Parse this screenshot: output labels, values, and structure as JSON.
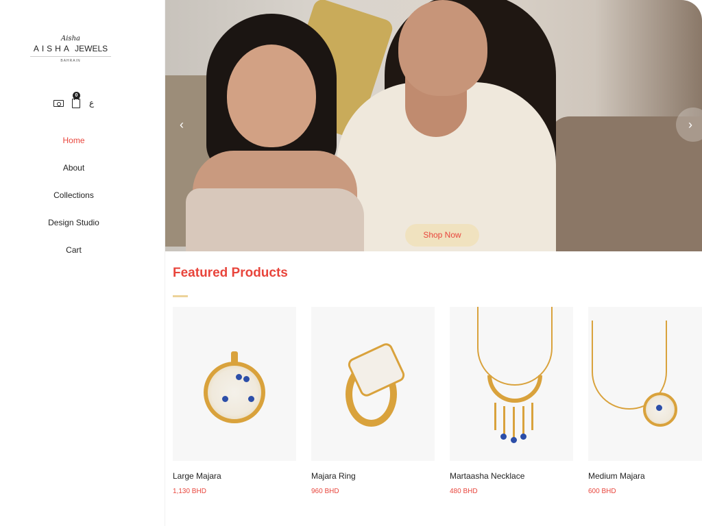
{
  "brand": {
    "script": "Aisha",
    "name_part1": "AISHA",
    "name_part2": "JEWELS",
    "location": "BAHRAIN"
  },
  "header_icons": {
    "currency_icon": "money-icon",
    "cart_icon": "shopping-bag-icon",
    "cart_count": "0",
    "language_toggle": "ع"
  },
  "nav": {
    "items": [
      {
        "label": "Home",
        "active": true
      },
      {
        "label": "About",
        "active": false
      },
      {
        "label": "Collections",
        "active": false
      },
      {
        "label": "Design Studio",
        "active": false
      },
      {
        "label": "Cart",
        "active": false
      }
    ]
  },
  "hero": {
    "prev_icon": "‹",
    "next_icon": "›",
    "cta_label": "Shop Now"
  },
  "featured": {
    "title": "Featured Products",
    "products": [
      {
        "name": "Large Majara",
        "price": "1,130 BHD"
      },
      {
        "name": "Majara Ring",
        "price": "960 BHD"
      },
      {
        "name": "Martaasha Necklace",
        "price": "480 BHD"
      },
      {
        "name": "Medium Majara",
        "price": "600 BHD"
      }
    ]
  },
  "colors": {
    "accent": "#e8453c",
    "button_bg": "#f0e2bf",
    "underline": "#ecd39a",
    "gold": "#d9a23c"
  }
}
